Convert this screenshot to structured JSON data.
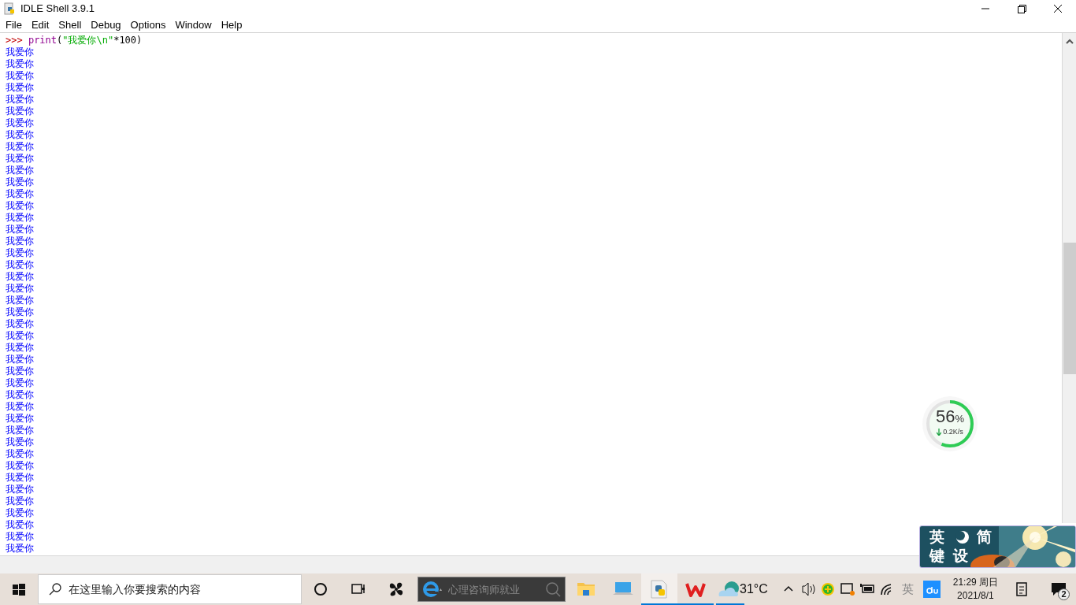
{
  "window": {
    "title": "IDLE Shell 3.9.1"
  },
  "menu": [
    "File",
    "Edit",
    "Shell",
    "Debug",
    "Options",
    "Window",
    "Help"
  ],
  "shell": {
    "prompt": ">>>",
    "command": [
      {
        "kind": "builtin",
        "text": "print"
      },
      {
        "kind": "plain",
        "text": "("
      },
      {
        "kind": "string",
        "text": "\"我爱你\\n\""
      },
      {
        "kind": "plain",
        "text": "*100)"
      }
    ],
    "output_lines": [
      "我爱你",
      "我爱你",
      "我爱你",
      "我爱你",
      "我爱你",
      "我爱你",
      "我爱你",
      "我爱你",
      "我爱你",
      "我爱你",
      "我爱你",
      "我爱你",
      "我爱你",
      "我爱你",
      "我爱你",
      "我爱你",
      "我爱你",
      "我爱你",
      "我爱你",
      "我爱你",
      "我爱你",
      "我爱你",
      "我爱你",
      "我爱你",
      "我爱你",
      "我爱你",
      "我爱你",
      "我爱你",
      "我爱你",
      "我爱你",
      "我爱你",
      "我爱你",
      "我爱你",
      "我爱你",
      "我爱你",
      "我爱你",
      "我爱你",
      "我爱你",
      "我爱你",
      "我爱你",
      "我爱你",
      "我爱你",
      "我爱你"
    ]
  },
  "net_widget": {
    "percent": "56",
    "unit": "%",
    "speed": "0.2K/s",
    "level": 0.56
  },
  "ime_widget": {
    "chars": [
      "英",
      "简",
      "键",
      "设"
    ]
  },
  "taskbar": {
    "search": {
      "placeholder": "在这里输入你要搜索的内容"
    },
    "browser_search": {
      "placeholder": "心理咨询师就业"
    },
    "apps": [
      {
        "kind": "folder",
        "running": false,
        "selected": false
      },
      {
        "kind": "computer",
        "running": false,
        "selected": false
      },
      {
        "kind": "python",
        "running": true,
        "selected": true
      },
      {
        "kind": "wps",
        "running": true,
        "selected": false
      }
    ],
    "weather": {
      "temp": "31°C",
      "running": true
    },
    "ime": "英",
    "time": "21:29 周日",
    "date": "2021/8/1",
    "notification_count": "2"
  }
}
